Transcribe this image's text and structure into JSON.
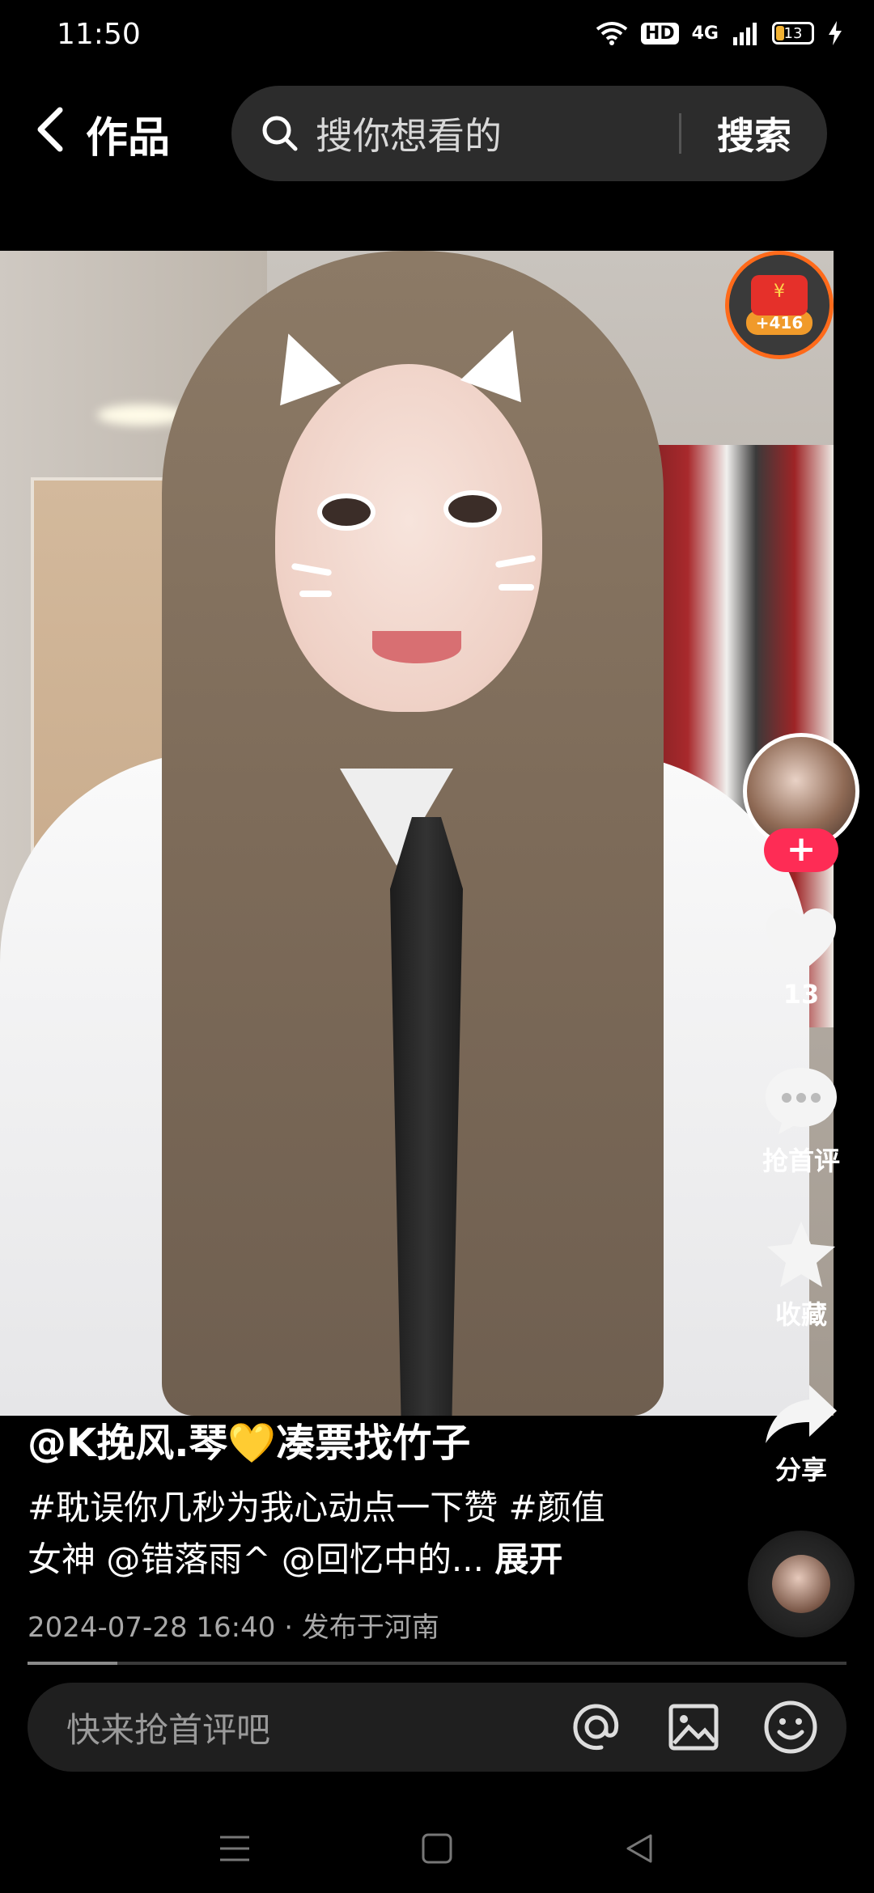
{
  "status_bar": {
    "time": "11:50",
    "hd_label": "HD",
    "network_label": "4G",
    "battery_level": "13"
  },
  "header": {
    "title": "作品",
    "search_placeholder": "搜你想看的",
    "search_button": "搜索"
  },
  "reward": {
    "value": "+416"
  },
  "actions": {
    "follow_label": "+",
    "like_count": "13",
    "comment_label": "抢首评",
    "favorite_label": "收藏",
    "share_label": "分享"
  },
  "post": {
    "author": "@K挽风.琴💛凑票找竹子",
    "description": "#耽误你几秒为我心动点一下赞 #颜值女神 @错落雨^ @回忆中的...",
    "expand_label": "展开",
    "meta": "2024-07-28 16:40 · 发布于河南",
    "progress": 0.11
  },
  "comment_bar": {
    "placeholder": "快来抢首评吧"
  },
  "icons": {
    "back": "chevron-left-icon",
    "search": "search-icon",
    "like": "heart-icon",
    "comment": "comment-bubble-icon",
    "favorite": "star-icon",
    "share": "share-arrow-icon",
    "mention": "at-icon",
    "image": "image-icon",
    "emoji": "emoji-icon"
  },
  "colors": {
    "accent": "#fe2c55",
    "reward_ring": "#ff6a1a",
    "background": "#000000"
  }
}
